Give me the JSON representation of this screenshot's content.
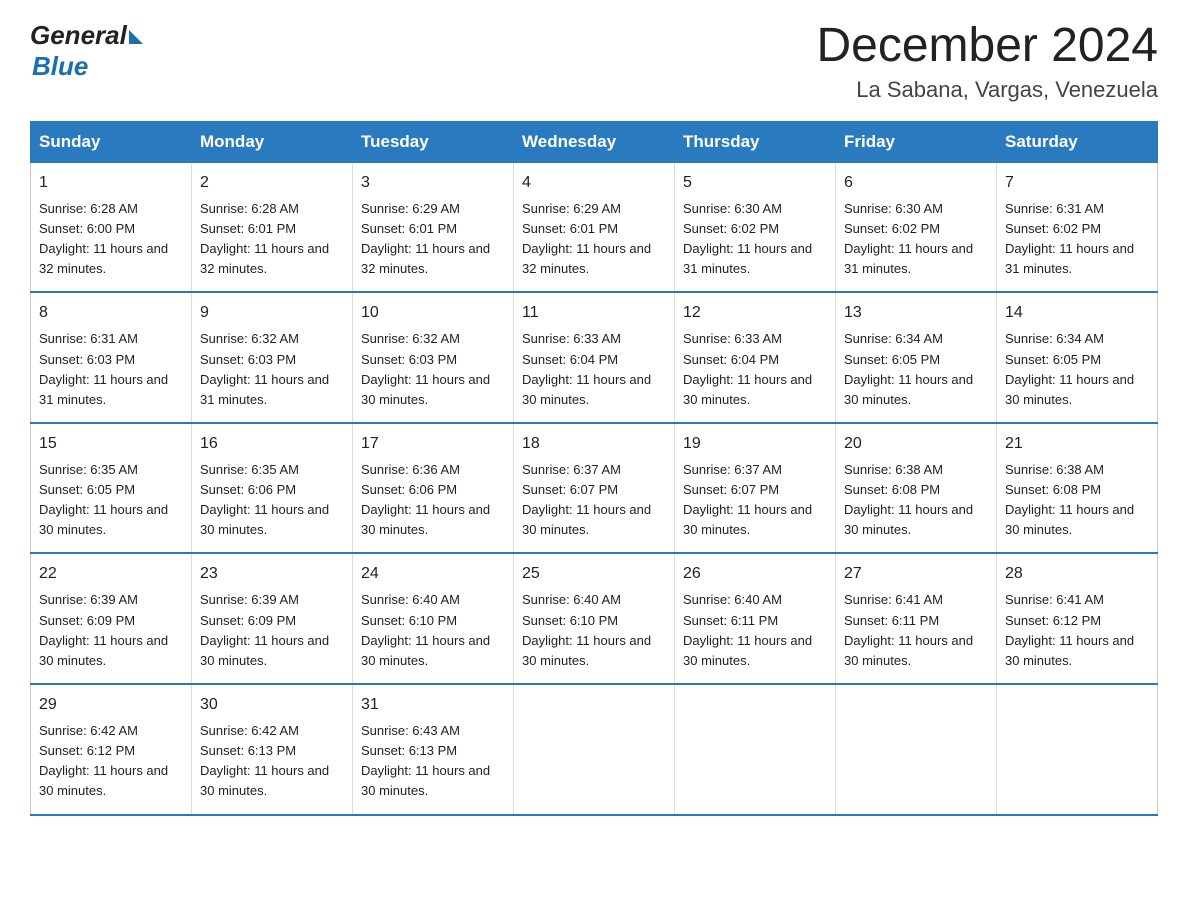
{
  "header": {
    "logo_general": "General",
    "logo_blue": "Blue",
    "title": "December 2024",
    "subtitle": "La Sabana, Vargas, Venezuela"
  },
  "columns": [
    "Sunday",
    "Monday",
    "Tuesday",
    "Wednesday",
    "Thursday",
    "Friday",
    "Saturday"
  ],
  "weeks": [
    [
      {
        "day": "1",
        "sunrise": "Sunrise: 6:28 AM",
        "sunset": "Sunset: 6:00 PM",
        "daylight": "Daylight: 11 hours and 32 minutes."
      },
      {
        "day": "2",
        "sunrise": "Sunrise: 6:28 AM",
        "sunset": "Sunset: 6:01 PM",
        "daylight": "Daylight: 11 hours and 32 minutes."
      },
      {
        "day": "3",
        "sunrise": "Sunrise: 6:29 AM",
        "sunset": "Sunset: 6:01 PM",
        "daylight": "Daylight: 11 hours and 32 minutes."
      },
      {
        "day": "4",
        "sunrise": "Sunrise: 6:29 AM",
        "sunset": "Sunset: 6:01 PM",
        "daylight": "Daylight: 11 hours and 32 minutes."
      },
      {
        "day": "5",
        "sunrise": "Sunrise: 6:30 AM",
        "sunset": "Sunset: 6:02 PM",
        "daylight": "Daylight: 11 hours and 31 minutes."
      },
      {
        "day": "6",
        "sunrise": "Sunrise: 6:30 AM",
        "sunset": "Sunset: 6:02 PM",
        "daylight": "Daylight: 11 hours and 31 minutes."
      },
      {
        "day": "7",
        "sunrise": "Sunrise: 6:31 AM",
        "sunset": "Sunset: 6:02 PM",
        "daylight": "Daylight: 11 hours and 31 minutes."
      }
    ],
    [
      {
        "day": "8",
        "sunrise": "Sunrise: 6:31 AM",
        "sunset": "Sunset: 6:03 PM",
        "daylight": "Daylight: 11 hours and 31 minutes."
      },
      {
        "day": "9",
        "sunrise": "Sunrise: 6:32 AM",
        "sunset": "Sunset: 6:03 PM",
        "daylight": "Daylight: 11 hours and 31 minutes."
      },
      {
        "day": "10",
        "sunrise": "Sunrise: 6:32 AM",
        "sunset": "Sunset: 6:03 PM",
        "daylight": "Daylight: 11 hours and 30 minutes."
      },
      {
        "day": "11",
        "sunrise": "Sunrise: 6:33 AM",
        "sunset": "Sunset: 6:04 PM",
        "daylight": "Daylight: 11 hours and 30 minutes."
      },
      {
        "day": "12",
        "sunrise": "Sunrise: 6:33 AM",
        "sunset": "Sunset: 6:04 PM",
        "daylight": "Daylight: 11 hours and 30 minutes."
      },
      {
        "day": "13",
        "sunrise": "Sunrise: 6:34 AM",
        "sunset": "Sunset: 6:05 PM",
        "daylight": "Daylight: 11 hours and 30 minutes."
      },
      {
        "day": "14",
        "sunrise": "Sunrise: 6:34 AM",
        "sunset": "Sunset: 6:05 PM",
        "daylight": "Daylight: 11 hours and 30 minutes."
      }
    ],
    [
      {
        "day": "15",
        "sunrise": "Sunrise: 6:35 AM",
        "sunset": "Sunset: 6:05 PM",
        "daylight": "Daylight: 11 hours and 30 minutes."
      },
      {
        "day": "16",
        "sunrise": "Sunrise: 6:35 AM",
        "sunset": "Sunset: 6:06 PM",
        "daylight": "Daylight: 11 hours and 30 minutes."
      },
      {
        "day": "17",
        "sunrise": "Sunrise: 6:36 AM",
        "sunset": "Sunset: 6:06 PM",
        "daylight": "Daylight: 11 hours and 30 minutes."
      },
      {
        "day": "18",
        "sunrise": "Sunrise: 6:37 AM",
        "sunset": "Sunset: 6:07 PM",
        "daylight": "Daylight: 11 hours and 30 minutes."
      },
      {
        "day": "19",
        "sunrise": "Sunrise: 6:37 AM",
        "sunset": "Sunset: 6:07 PM",
        "daylight": "Daylight: 11 hours and 30 minutes."
      },
      {
        "day": "20",
        "sunrise": "Sunrise: 6:38 AM",
        "sunset": "Sunset: 6:08 PM",
        "daylight": "Daylight: 11 hours and 30 minutes."
      },
      {
        "day": "21",
        "sunrise": "Sunrise: 6:38 AM",
        "sunset": "Sunset: 6:08 PM",
        "daylight": "Daylight: 11 hours and 30 minutes."
      }
    ],
    [
      {
        "day": "22",
        "sunrise": "Sunrise: 6:39 AM",
        "sunset": "Sunset: 6:09 PM",
        "daylight": "Daylight: 11 hours and 30 minutes."
      },
      {
        "day": "23",
        "sunrise": "Sunrise: 6:39 AM",
        "sunset": "Sunset: 6:09 PM",
        "daylight": "Daylight: 11 hours and 30 minutes."
      },
      {
        "day": "24",
        "sunrise": "Sunrise: 6:40 AM",
        "sunset": "Sunset: 6:10 PM",
        "daylight": "Daylight: 11 hours and 30 minutes."
      },
      {
        "day": "25",
        "sunrise": "Sunrise: 6:40 AM",
        "sunset": "Sunset: 6:10 PM",
        "daylight": "Daylight: 11 hours and 30 minutes."
      },
      {
        "day": "26",
        "sunrise": "Sunrise: 6:40 AM",
        "sunset": "Sunset: 6:11 PM",
        "daylight": "Daylight: 11 hours and 30 minutes."
      },
      {
        "day": "27",
        "sunrise": "Sunrise: 6:41 AM",
        "sunset": "Sunset: 6:11 PM",
        "daylight": "Daylight: 11 hours and 30 minutes."
      },
      {
        "day": "28",
        "sunrise": "Sunrise: 6:41 AM",
        "sunset": "Sunset: 6:12 PM",
        "daylight": "Daylight: 11 hours and 30 minutes."
      }
    ],
    [
      {
        "day": "29",
        "sunrise": "Sunrise: 6:42 AM",
        "sunset": "Sunset: 6:12 PM",
        "daylight": "Daylight: 11 hours and 30 minutes."
      },
      {
        "day": "30",
        "sunrise": "Sunrise: 6:42 AM",
        "sunset": "Sunset: 6:13 PM",
        "daylight": "Daylight: 11 hours and 30 minutes."
      },
      {
        "day": "31",
        "sunrise": "Sunrise: 6:43 AM",
        "sunset": "Sunset: 6:13 PM",
        "daylight": "Daylight: 11 hours and 30 minutes."
      },
      null,
      null,
      null,
      null
    ]
  ]
}
